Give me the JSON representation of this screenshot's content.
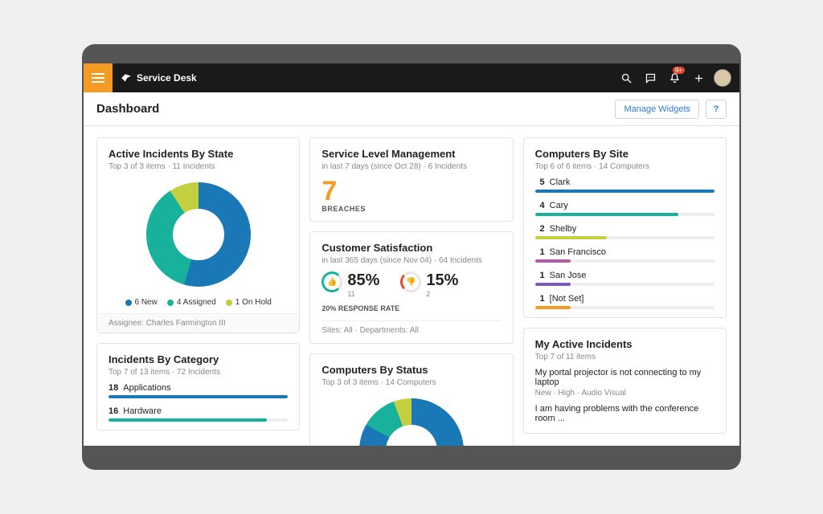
{
  "header": {
    "app_name": "Service Desk",
    "notifications_badge": "9+"
  },
  "page": {
    "title": "Dashboard",
    "manage_widgets": "Manage Widgets",
    "help": "?"
  },
  "widgets": {
    "active_incidents_by_state": {
      "title": "Active Incidents By State",
      "subtitle": "Top 3 of 3 items  ·  11 Incidents",
      "legend": {
        "new": "6 New",
        "assigned": "4 Assigned",
        "onhold": "1 On Hold"
      },
      "footer": "Assignee: Charles Farmington III"
    },
    "incidents_by_category": {
      "title": "Incidents By Category",
      "subtitle": "Top 7 of 13 items  ·  72 Incidents",
      "rows": [
        {
          "count": "18",
          "label": "Applications",
          "color": "#1978b5",
          "pct": 100
        },
        {
          "count": "16",
          "label": "Hardware",
          "color": "#18b19b",
          "pct": 88
        }
      ]
    },
    "sla": {
      "title": "Service Level Management",
      "subtitle": "in last 7 days (since Oct 28)  ·  6 Incidents",
      "value": "7",
      "value_label": "BREACHES"
    },
    "csat": {
      "title": "Customer Satisfaction",
      "subtitle": "in last 365 days (since Nov 04)  ·  64 Incidents",
      "good_pct": "85%",
      "good_count": "11",
      "bad_pct": "15%",
      "bad_count": "2",
      "response_rate": "20% RESPONSE RATE",
      "filters": "Sites: All  ·  Departments: All"
    },
    "computers_by_status": {
      "title": "Computers By Status",
      "subtitle": "Top 3 of 3 items  ·  14 Computers"
    },
    "computers_by_site": {
      "title": "Computers By Site",
      "subtitle": "Top 6 of 6 items  ·  14 Computers",
      "rows": [
        {
          "count": "5",
          "label": "Clark",
          "color": "#1978b5",
          "pct": 100
        },
        {
          "count": "4",
          "label": "Cary",
          "color": "#18b19b",
          "pct": 80
        },
        {
          "count": "2",
          "label": "Shelby",
          "color": "#c4cf3f",
          "pct": 40
        },
        {
          "count": "1",
          "label": "San Francisco",
          "color": "#b85aa8",
          "pct": 20
        },
        {
          "count": "1",
          "label": "San Jose",
          "color": "#7a5bb8",
          "pct": 20
        },
        {
          "count": "1",
          "label": "[Not Set]",
          "color": "#f59b23",
          "pct": 20
        }
      ]
    },
    "my_active_incidents": {
      "title": "My Active Incidents",
      "subtitle": "Top 7 of 11 items",
      "items": [
        {
          "title": "My portal projector is not connecting to my laptop",
          "meta": "New  ·  High  ·  Audio Visual"
        },
        {
          "title": "I am having problems with the conference room ...",
          "meta": ""
        }
      ]
    }
  },
  "chart_data": [
    {
      "type": "pie",
      "title": "Active Incidents By State",
      "categories": [
        "New",
        "Assigned",
        "On Hold"
      ],
      "values": [
        6,
        4,
        1
      ],
      "colors": [
        "#1978b5",
        "#18b19b",
        "#c4cf3f"
      ]
    },
    {
      "type": "bar",
      "title": "Computers By Site",
      "categories": [
        "Clark",
        "Cary",
        "Shelby",
        "San Francisco",
        "San Jose",
        "[Not Set]"
      ],
      "values": [
        5,
        4,
        2,
        1,
        1,
        1
      ],
      "xlim": [
        0,
        5
      ]
    },
    {
      "type": "bar",
      "title": "Incidents By Category",
      "categories": [
        "Applications",
        "Hardware"
      ],
      "values": [
        18,
        16
      ],
      "xlim": [
        0,
        18
      ]
    },
    {
      "type": "pie",
      "title": "Customer Satisfaction",
      "categories": [
        "Positive",
        "Negative"
      ],
      "values": [
        85,
        15
      ]
    }
  ]
}
